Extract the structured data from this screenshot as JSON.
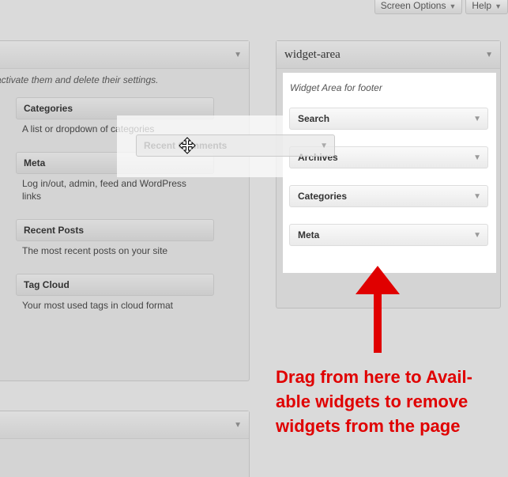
{
  "screen_meta": {
    "screen_options_label": "Screen Options",
    "help_label": "Help"
  },
  "available_widgets": {
    "description": "activate them and delete their settings.",
    "widgets": [
      {
        "title": "Categories",
        "description": "A list or dropdown of categories"
      },
      {
        "title": "Meta",
        "description": "Log in/out, admin, feed and WordPress links"
      },
      {
        "title": "Recent Posts",
        "description": "The most recent posts on your site"
      },
      {
        "title": "Tag Cloud",
        "description": "Your most used tags in cloud format"
      }
    ]
  },
  "widget_area": {
    "title": "widget-area",
    "description": "Widget Area for footer",
    "widgets": [
      {
        "title": "Search"
      },
      {
        "title": "Archives"
      },
      {
        "title": "Categories"
      },
      {
        "title": "Meta"
      }
    ]
  },
  "dragging_widget": {
    "title": "Recent Comments"
  },
  "annotation": {
    "text": "Drag from here to Avail-able widgets to remove widgets from the page",
    "lines": [
      "Drag from here to Avail-",
      "able widgets to remove",
      "widgets from the page"
    ],
    "color": "#e00000"
  },
  "icons": {
    "panel_toggle": "triangle-down-icon",
    "cursor": "move-cursor-icon",
    "annotation_arrow": "red-up-arrow-icon"
  }
}
